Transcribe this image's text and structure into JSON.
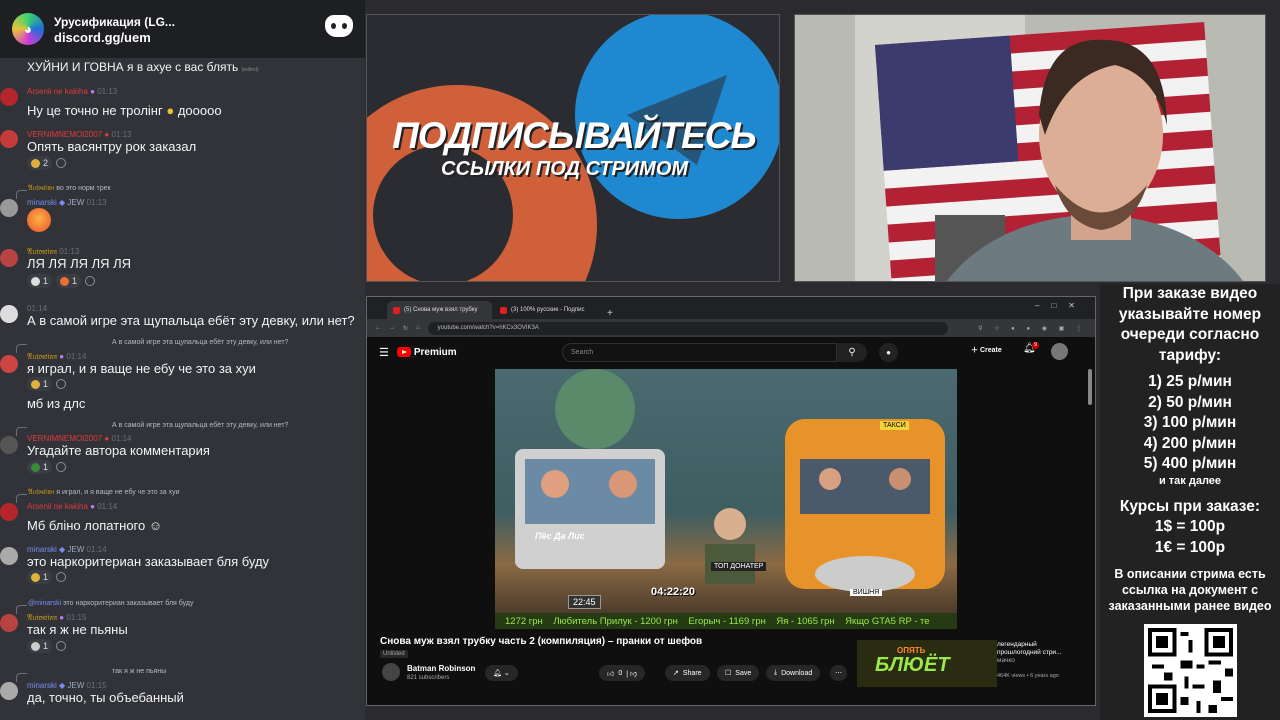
{
  "chat": {
    "server_name": "Урусификация (LG...",
    "server_link": "discord.gg/uem",
    "messages": [
      {
        "text": "ХУЙНИ И ГОВНА я в ахуе с вас блять",
        "edited": "(edited)"
      },
      {
        "user": "Arsenii ne kakiha",
        "time": "01:13",
        "text": "Ну це точно не тролінг",
        "suffix": "дооооо"
      },
      {
        "user": "VERNIMNEMOI2007",
        "time": "01:13",
        "text": "Опять васянтру рок заказал",
        "react": "2"
      },
      {
        "reply_text": "во это норм трек",
        "user": "minarski",
        "tag": "JEW",
        "time": "01:13"
      },
      {
        "time": "01:13",
        "text": "ЛЯ ЛЯ ЛЯ ЛЯ ЛЯ",
        "reacts": [
          "1",
          "1"
        ]
      },
      {
        "time": "01:14",
        "text": "А в самой игре эта щупальца ебёт эту девку, или нет?"
      },
      {
        "reply_text": "А в самой игре эта щупальца ебёт эту девку, или нет?",
        "time": "01:14",
        "text": "я играл, и я ваще не ебу че это за хуи",
        "react": "1"
      },
      {
        "text": "мб из длс"
      },
      {
        "reply_text": "А в самой игре эта щупальца ебёт эту девку, или нет?",
        "user": "VERNIMNEMOI2007",
        "time": "01:14",
        "text": "Угадайте автора комментария",
        "react": "1"
      },
      {
        "reply_text": "я играл, и я ваще не ебу че это за хуи",
        "user": "Arsenii ne kakiha",
        "time": "01:14",
        "text": "Мб бліно лопатного"
      },
      {
        "user": "minarski",
        "tag": "JEW",
        "time": "01:14",
        "text": "это наркоритериан заказывает бля буду",
        "react": "1"
      },
      {
        "reply_text": "это наркоритериан заказывает бля буду",
        "reply_user": "@minarski",
        "time": "01:15",
        "text": "так я ж не пьяны",
        "react": "1"
      },
      {
        "reply_text": "так я ж не пьяны",
        "user": "minarski",
        "tag": "JEW",
        "time": "01:15",
        "text": "да, точно, ты объебанный"
      }
    ]
  },
  "banner": {
    "headline": "ПОДПИСЫВАЙТЕСЬ",
    "subline": "ССЫЛКИ ПОД СТРИМОМ"
  },
  "browser": {
    "tab1": "(5) Снова муж взял трубку",
    "tab2": "(3) 100% русские - Подпис",
    "url": "youtube.com/watch?v=hKCx3OVIK3A",
    "logo": "Premium",
    "search_placeholder": "Search",
    "create": "Create",
    "notif_count": "9",
    "video": {
      "time_overlay": "04:22:20",
      "clock": "22:45",
      "plate": "ВИШНЯ",
      "sign_left": "Пёс Да Лис",
      "sign_top": "ТОП ДОНАТЕР",
      "taxi": "ТАКСИ",
      "ticker": "1272 грн    Любитель Прилук - 1200 грн    Егорыч - 1169 грн    Яя - 1065 грн    Якщо GTA5 RP - те"
    },
    "title": "Снова муж взял трубку часть 2 (компиляция) – пранки от шефов",
    "unlisted": "Unlisted",
    "channel": "Batman Robinson",
    "subscribers": "821 subscribers",
    "likes": "0",
    "share": "Share",
    "save": "Save",
    "download": "Download",
    "suggestion": {
      "title": "легендарный прошлогодний стри...",
      "channel": "мачко",
      "meta": "464K views • 6 years ago",
      "thumb_text": "БЛЮЁТ",
      "thumb_top": "ОПЯТЬ"
    }
  },
  "info": {
    "p1": "При заказе видео указывайте номер очереди согласно тарифу:",
    "tariffs": [
      "1) 25 р/мин",
      "2) 50 р/мин",
      "3) 100 р/мин",
      "4) 200 р/мин",
      "5) 400 р/мин"
    ],
    "etc": "и так далее",
    "rates_title": "Курсы при заказе:",
    "rate1": "1$ = 100р",
    "rate2": "1€ = 100р",
    "p3": "В описании стрима есть ссылка на документ с заказанными ранее видео"
  }
}
